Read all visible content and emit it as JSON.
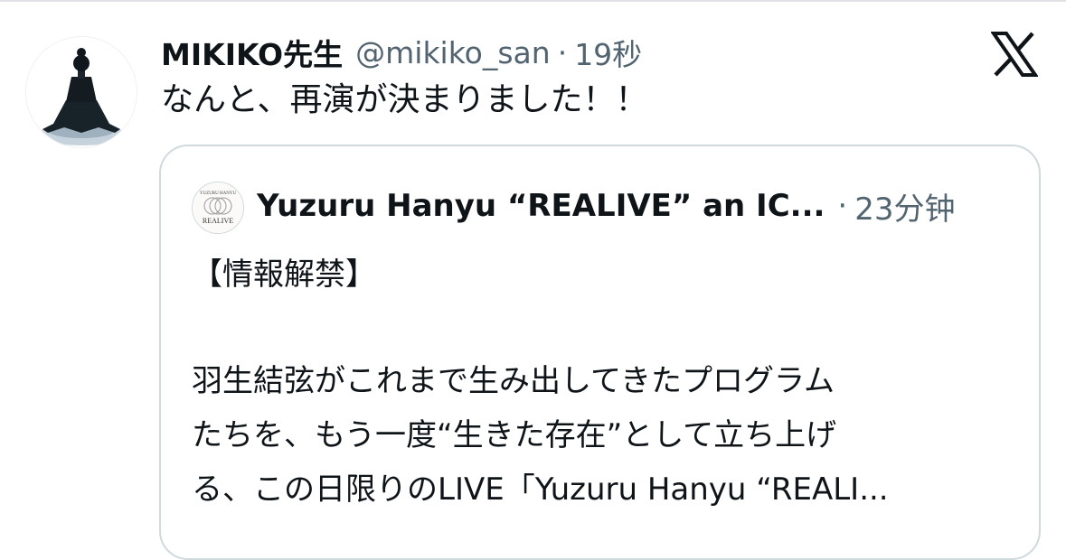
{
  "tweet": {
    "display_name": "MIKIKO先生",
    "handle": "@mikiko_san",
    "separator": "·",
    "time": "19秒",
    "text": "なんと、再演が決まりました！！",
    "avatar_icon": "meditating-figure-avatar",
    "platform_icon": "x-logo-icon"
  },
  "quote": {
    "avatar_text_top": "YUZURU HANYU",
    "avatar_text_main": "REALIVE",
    "display_name": "Yuzuru Hanyu “REALIVE” an IC...",
    "separator": "·",
    "time": "23分钟",
    "lines": [
      "【情報解禁】",
      "羽生結弦がこれまで生み出してきたプログラム",
      "たちを、もう一度“生きた存在”として立ち上げ",
      "る、この日限りのLIVE「Yuzuru Hanyu “REALI..."
    ]
  },
  "colors": {
    "text_primary": "#0f1419",
    "text_secondary": "#536471",
    "border": "#cfd9de"
  }
}
